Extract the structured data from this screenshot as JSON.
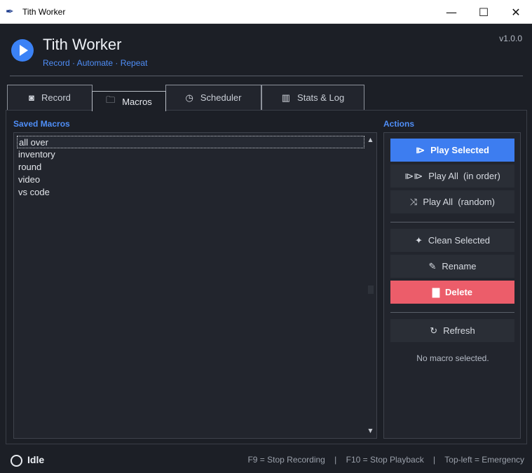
{
  "window": {
    "title": "Tith Worker",
    "minimize": "—",
    "maximize": "☐",
    "close": "✕"
  },
  "header": {
    "title": "Tith Worker",
    "subtitle": "Record · Automate · Repeat",
    "version": "v1.0.0"
  },
  "tabs": [
    {
      "label": "Record",
      "icon": "record-icon"
    },
    {
      "label": "Macros",
      "icon": "folder-icon",
      "active": true
    },
    {
      "label": "Scheduler",
      "icon": "clock-icon"
    },
    {
      "label": "Stats & Log",
      "icon": "chart-icon"
    }
  ],
  "macros": {
    "label": "Saved Macros",
    "items": [
      "all over",
      "inventory",
      "round",
      "video",
      "vs code"
    ],
    "selected": "all over"
  },
  "actions": {
    "label": "Actions",
    "play_selected": "Play Selected",
    "play_all_order": "Play All  (in order)",
    "play_all_random": "Play All  (random)",
    "clean_selected": "Clean Selected",
    "rename": "Rename",
    "delete": "Delete",
    "refresh": "Refresh",
    "status": "No macro selected."
  },
  "statusbar": {
    "state": "Idle",
    "hints": "F9 = Stop Recording    |    F10 = Stop Playback    |    Top-left = Emergency"
  },
  "colors": {
    "accent": "#3d7df0",
    "danger": "#ec5d6a",
    "link": "#4f8ef7",
    "background": "#1c1f26"
  }
}
